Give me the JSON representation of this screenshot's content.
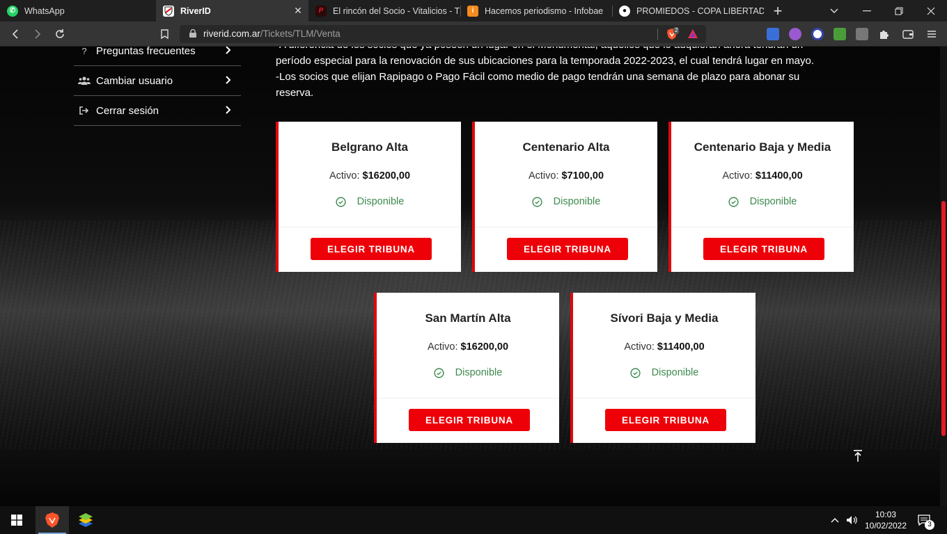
{
  "browser": {
    "tabs": [
      {
        "title": "WhatsApp",
        "icon": "whatsapp-icon"
      },
      {
        "title": "RiverID",
        "icon": "river-plate-icon",
        "active": true
      },
      {
        "title": "El rincón del Socio - Vitalicios - TLM",
        "icon": "rincon-socio-icon"
      },
      {
        "title": "Hacemos periodismo - Infobae",
        "icon": "infobae-icon"
      },
      {
        "title": "PROMIEDOS - COPA LIBERTADORES",
        "icon": "promiedos-icon"
      }
    ],
    "new_tab": "+",
    "url_host": "riverid.com.ar",
    "url_path": "/Tickets/TLM/Venta",
    "brave_badge": "2"
  },
  "sidebar": {
    "items": [
      {
        "label": "Preguntas frecuentes",
        "icon": "question-icon"
      },
      {
        "label": "Cambiar usuario",
        "icon": "users-icon"
      },
      {
        "label": "Cerrar sesión",
        "icon": "logout-icon"
      }
    ]
  },
  "info": {
    "line1": "-A diferencia de los socios que ya poseen un lugar en el Monumental, aquellos que lo adquieran ahora tendrán un",
    "line2": "período especial para la renovación de sus ubicaciones para la temporada 2022-2023, el cual tendrá lugar en mayo.",
    "line3": "-Los socios que elijan Rapipago o Pago Fácil como medio de pago tendrán una semana de plazo para abonar su",
    "line4": "reserva."
  },
  "cards": [
    {
      "name": "Belgrano Alta",
      "price_label": "Activo:",
      "price": "$16200,00",
      "status": "Disponible",
      "button": "ELEGIR TRIBUNA"
    },
    {
      "name": "Centenario Alta",
      "price_label": "Activo:",
      "price": "$7100,00",
      "status": "Disponible",
      "button": "ELEGIR TRIBUNA"
    },
    {
      "name": "Centenario Baja y Media",
      "price_label": "Activo:",
      "price": "$11400,00",
      "status": "Disponible",
      "button": "ELEGIR TRIBUNA"
    },
    {
      "name": "San Martín Alta",
      "price_label": "Activo:",
      "price": "$16200,00",
      "status": "Disponible",
      "button": "ELEGIR TRIBUNA"
    },
    {
      "name": "Sívori Baja y Media",
      "price_label": "Activo:",
      "price": "$11400,00",
      "status": "Disponible",
      "button": "ELEGIR TRIBUNA"
    }
  ],
  "colors": {
    "accent": "#ee0008",
    "available": "#3d8a4e"
  },
  "taskbar": {
    "time": "10:03",
    "date": "10/02/2022",
    "notifications": "3"
  }
}
